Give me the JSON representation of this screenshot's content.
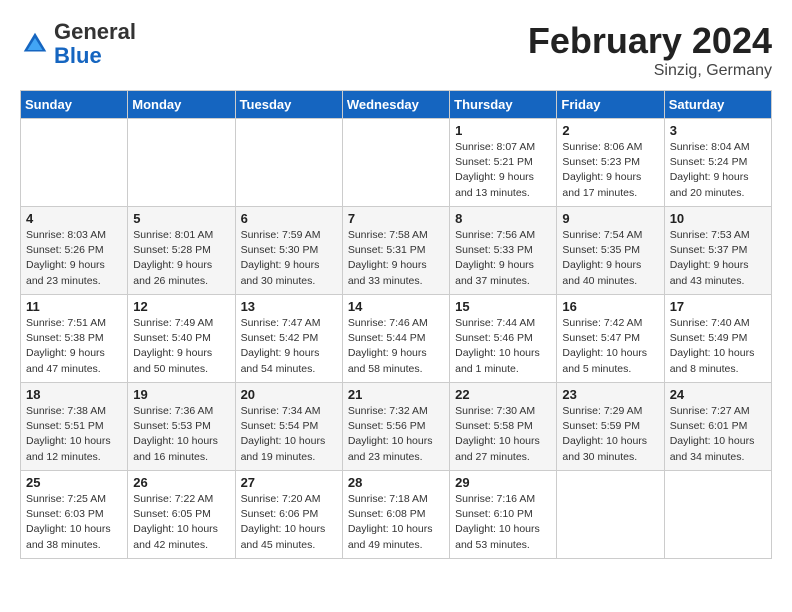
{
  "header": {
    "logo_general": "General",
    "logo_blue": "Blue",
    "month_year": "February 2024",
    "location": "Sinzig, Germany"
  },
  "weekdays": [
    "Sunday",
    "Monday",
    "Tuesday",
    "Wednesday",
    "Thursday",
    "Friday",
    "Saturday"
  ],
  "weeks": [
    [
      {
        "day": "",
        "info": ""
      },
      {
        "day": "",
        "info": ""
      },
      {
        "day": "",
        "info": ""
      },
      {
        "day": "",
        "info": ""
      },
      {
        "day": "1",
        "info": "Sunrise: 8:07 AM\nSunset: 5:21 PM\nDaylight: 9 hours\nand 13 minutes."
      },
      {
        "day": "2",
        "info": "Sunrise: 8:06 AM\nSunset: 5:23 PM\nDaylight: 9 hours\nand 17 minutes."
      },
      {
        "day": "3",
        "info": "Sunrise: 8:04 AM\nSunset: 5:24 PM\nDaylight: 9 hours\nand 20 minutes."
      }
    ],
    [
      {
        "day": "4",
        "info": "Sunrise: 8:03 AM\nSunset: 5:26 PM\nDaylight: 9 hours\nand 23 minutes."
      },
      {
        "day": "5",
        "info": "Sunrise: 8:01 AM\nSunset: 5:28 PM\nDaylight: 9 hours\nand 26 minutes."
      },
      {
        "day": "6",
        "info": "Sunrise: 7:59 AM\nSunset: 5:30 PM\nDaylight: 9 hours\nand 30 minutes."
      },
      {
        "day": "7",
        "info": "Sunrise: 7:58 AM\nSunset: 5:31 PM\nDaylight: 9 hours\nand 33 minutes."
      },
      {
        "day": "8",
        "info": "Sunrise: 7:56 AM\nSunset: 5:33 PM\nDaylight: 9 hours\nand 37 minutes."
      },
      {
        "day": "9",
        "info": "Sunrise: 7:54 AM\nSunset: 5:35 PM\nDaylight: 9 hours\nand 40 minutes."
      },
      {
        "day": "10",
        "info": "Sunrise: 7:53 AM\nSunset: 5:37 PM\nDaylight: 9 hours\nand 43 minutes."
      }
    ],
    [
      {
        "day": "11",
        "info": "Sunrise: 7:51 AM\nSunset: 5:38 PM\nDaylight: 9 hours\nand 47 minutes."
      },
      {
        "day": "12",
        "info": "Sunrise: 7:49 AM\nSunset: 5:40 PM\nDaylight: 9 hours\nand 50 minutes."
      },
      {
        "day": "13",
        "info": "Sunrise: 7:47 AM\nSunset: 5:42 PM\nDaylight: 9 hours\nand 54 minutes."
      },
      {
        "day": "14",
        "info": "Sunrise: 7:46 AM\nSunset: 5:44 PM\nDaylight: 9 hours\nand 58 minutes."
      },
      {
        "day": "15",
        "info": "Sunrise: 7:44 AM\nSunset: 5:46 PM\nDaylight: 10 hours\nand 1 minute."
      },
      {
        "day": "16",
        "info": "Sunrise: 7:42 AM\nSunset: 5:47 PM\nDaylight: 10 hours\nand 5 minutes."
      },
      {
        "day": "17",
        "info": "Sunrise: 7:40 AM\nSunset: 5:49 PM\nDaylight: 10 hours\nand 8 minutes."
      }
    ],
    [
      {
        "day": "18",
        "info": "Sunrise: 7:38 AM\nSunset: 5:51 PM\nDaylight: 10 hours\nand 12 minutes."
      },
      {
        "day": "19",
        "info": "Sunrise: 7:36 AM\nSunset: 5:53 PM\nDaylight: 10 hours\nand 16 minutes."
      },
      {
        "day": "20",
        "info": "Sunrise: 7:34 AM\nSunset: 5:54 PM\nDaylight: 10 hours\nand 19 minutes."
      },
      {
        "day": "21",
        "info": "Sunrise: 7:32 AM\nSunset: 5:56 PM\nDaylight: 10 hours\nand 23 minutes."
      },
      {
        "day": "22",
        "info": "Sunrise: 7:30 AM\nSunset: 5:58 PM\nDaylight: 10 hours\nand 27 minutes."
      },
      {
        "day": "23",
        "info": "Sunrise: 7:29 AM\nSunset: 5:59 PM\nDaylight: 10 hours\nand 30 minutes."
      },
      {
        "day": "24",
        "info": "Sunrise: 7:27 AM\nSunset: 6:01 PM\nDaylight: 10 hours\nand 34 minutes."
      }
    ],
    [
      {
        "day": "25",
        "info": "Sunrise: 7:25 AM\nSunset: 6:03 PM\nDaylight: 10 hours\nand 38 minutes."
      },
      {
        "day": "26",
        "info": "Sunrise: 7:22 AM\nSunset: 6:05 PM\nDaylight: 10 hours\nand 42 minutes."
      },
      {
        "day": "27",
        "info": "Sunrise: 7:20 AM\nSunset: 6:06 PM\nDaylight: 10 hours\nand 45 minutes."
      },
      {
        "day": "28",
        "info": "Sunrise: 7:18 AM\nSunset: 6:08 PM\nDaylight: 10 hours\nand 49 minutes."
      },
      {
        "day": "29",
        "info": "Sunrise: 7:16 AM\nSunset: 6:10 PM\nDaylight: 10 hours\nand 53 minutes."
      },
      {
        "day": "",
        "info": ""
      },
      {
        "day": "",
        "info": ""
      }
    ]
  ]
}
